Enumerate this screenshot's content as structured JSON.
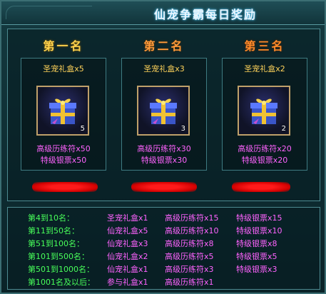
{
  "window": {
    "title": "仙宠争霸每日奖励"
  },
  "ranks": [
    {
      "title": "第一名",
      "title_color": "#ffd24d",
      "item_name": "圣宠礼盒x5",
      "gift_count": "5",
      "reward1": "高级历练符x50",
      "reward2": "特级银票x50"
    },
    {
      "title": "第二名",
      "title_color": "#ff9a3a",
      "item_name": "圣宠礼盒x3",
      "gift_count": "3",
      "reward1": "高级历练符x30",
      "reward2": "特级银票x30"
    },
    {
      "title": "第三名",
      "title_color": "#ff8a2a",
      "item_name": "圣宠礼盒x2",
      "gift_count": "2",
      "reward1": "高级历练符x20",
      "reward2": "特级银票x20"
    }
  ],
  "tiers": [
    {
      "rank": "第4到10名：",
      "item": "圣宠礼盒x1",
      "reward1": "高级历练符x15",
      "reward2": "特级银票x15"
    },
    {
      "rank": "第11到50名：",
      "item": "仙宠礼盒x5",
      "reward1": "高级历练符x10",
      "reward2": "特级银票x10"
    },
    {
      "rank": "第51到100名：",
      "item": "仙宠礼盒x3",
      "reward1": "高级历练符x8",
      "reward2": "特级银票x8"
    },
    {
      "rank": "第101到500名：",
      "item": "仙宠礼盒x2",
      "reward1": "高级历练符x5",
      "reward2": "特级银票x5"
    },
    {
      "rank": "第501到1000名：",
      "item": "仙宠礼盒x1",
      "reward1": "高级历练符x3",
      "reward2": "特级银票x3"
    },
    {
      "rank": "第1001名及以后：",
      "item": "参与礼盒x1",
      "reward1": "高级历练符x1",
      "reward2": ""
    }
  ],
  "colors": {
    "rank_text": "#48ff5a",
    "reward_text": "#ff63ff",
    "item_name_text": "#ffd35a",
    "redacted_bar": "#ff1a1a"
  },
  "icons": {
    "gift": "gift-box-icon"
  }
}
